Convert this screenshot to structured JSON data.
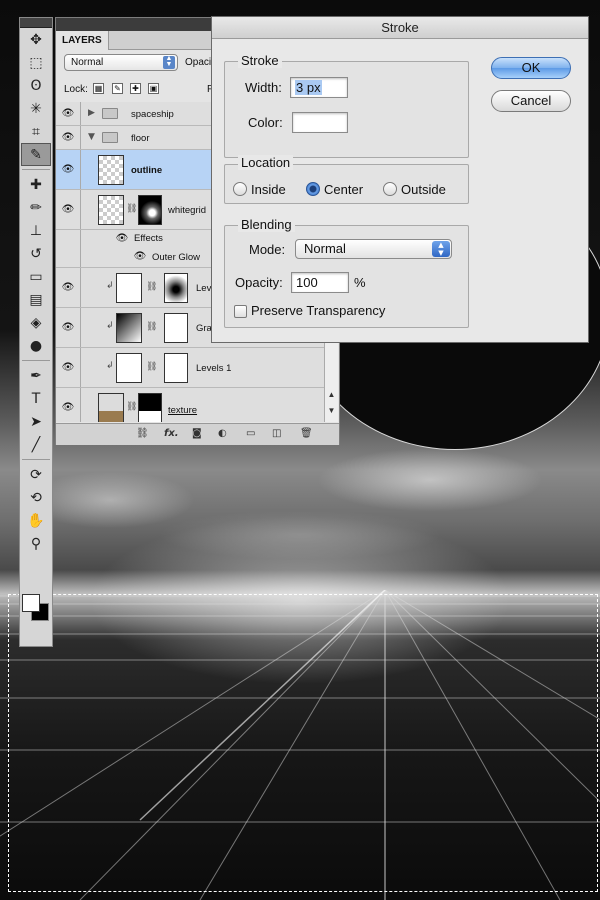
{
  "layers_panel": {
    "tab_label": "LAYERS",
    "blend_mode": "Normal",
    "opacity_label": "Opacit",
    "lock_label": "Lock:",
    "fill_label": "Fi",
    "layers": [
      {
        "name": "spaceship",
        "type": "group"
      },
      {
        "name": "floor",
        "type": "group"
      },
      {
        "name": "outline",
        "type": "layer",
        "selected": true
      },
      {
        "name": "whitegrid",
        "type": "layer"
      },
      {
        "name": "Effects",
        "type": "effects"
      },
      {
        "name": "Outer Glow",
        "type": "effect"
      },
      {
        "name": "Level",
        "type": "adjustment"
      },
      {
        "name": "Grad",
        "type": "adjustment"
      },
      {
        "name": "Levels 1",
        "type": "adjustment"
      },
      {
        "name": "texture",
        "type": "layer"
      }
    ],
    "footer_icons": [
      "link-icon",
      "fx-icon",
      "mask-icon",
      "adjustment-icon",
      "folder-icon",
      "new-layer-icon",
      "trash-icon"
    ]
  },
  "stroke_dialog": {
    "title": "Stroke",
    "stroke_group": "Stroke",
    "width_label": "Width:",
    "width_value": "3 px",
    "color_label": "Color:",
    "color_value": "#ffffff",
    "location_group": "Location",
    "location_options": [
      "Inside",
      "Center",
      "Outside"
    ],
    "location_selected": "Center",
    "blending_group": "Blending",
    "mode_label": "Mode:",
    "mode_value": "Normal",
    "opacity_label": "Opacity:",
    "opacity_value": "100",
    "opacity_unit": "%",
    "preserve_label": "Preserve Transparency",
    "preserve_checked": false,
    "ok_label": "OK",
    "cancel_label": "Cancel"
  },
  "tools": [
    "move-tool",
    "marquee-tool",
    "lasso-tool",
    "magic-wand-tool",
    "crop-tool",
    "eyedropper-tool",
    "healing-tool",
    "brush-tool",
    "stamp-tool",
    "history-brush-tool",
    "eraser-tool",
    "gradient-tool",
    "blur-tool",
    "dodge-tool",
    "pen-tool",
    "type-tool",
    "path-select-tool",
    "line-tool",
    "3d-rotate-tool",
    "3d-orbit-tool",
    "hand-tool",
    "zoom-tool"
  ],
  "colors": {
    "selection_highlight": "#b7d3f5",
    "accent_blue": "#5d9ae6",
    "foreground": "#ffffff",
    "background": "#000000"
  }
}
